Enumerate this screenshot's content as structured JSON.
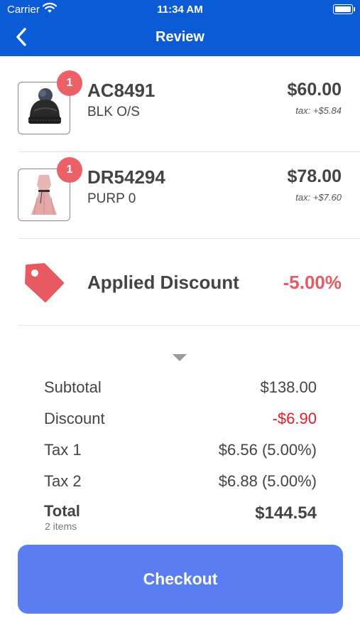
{
  "status_bar": {
    "carrier": "Carrier",
    "time": "11:34 AM"
  },
  "nav": {
    "title": "Review",
    "back_icon": "chevron-left-icon"
  },
  "items": [
    {
      "badge": "1",
      "sku": "AC8491",
      "variant": "BLK O/S",
      "price": "$60.00",
      "tax": "tax: +$5.84",
      "image": "beanie-hat"
    },
    {
      "badge": "1",
      "sku": "DR54294",
      "variant": "PURP 0",
      "price": "$78.00",
      "tax": "tax: +$7.60",
      "image": "pink-dress"
    }
  ],
  "discount": {
    "label": "Applied Discount",
    "value": "-5.00%",
    "icon": "price-tag-icon"
  },
  "summary": {
    "rows": [
      {
        "label": "Subtotal",
        "value": "$138.00"
      },
      {
        "label": "Discount",
        "value": "-$6.90"
      },
      {
        "label": "Tax 1",
        "value": "$6.56 (5.00%)"
      },
      {
        "label": "Tax 2",
        "value": "$6.88 (5.00%)"
      }
    ],
    "total_label": "Total",
    "total_items": "2 items",
    "total_value": "$144.54"
  },
  "checkout_label": "Checkout",
  "colors": {
    "nav_bg": "#0b5bd6",
    "badge": "#ec6168",
    "discount": "#e85a61",
    "discount_amount": "#e11f2a",
    "checkout_bg": "#5a7df1"
  }
}
